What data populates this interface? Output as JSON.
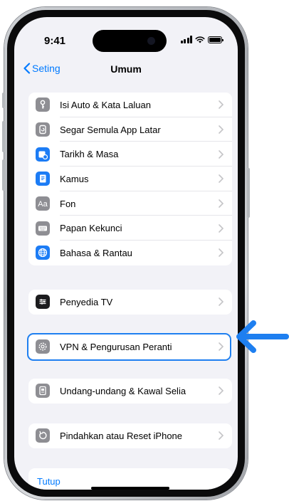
{
  "status_bar": {
    "time": "9:41"
  },
  "nav": {
    "back_label": "Seting",
    "title": "Umum"
  },
  "groups": [
    {
      "items": [
        {
          "label": "Isi Auto & Kata Laluan",
          "icon": "key-icon"
        },
        {
          "label": "Segar Semula App Latar",
          "icon": "refresh-icon"
        },
        {
          "label": "Tarikh & Masa",
          "icon": "calendar-clock-icon"
        },
        {
          "label": "Kamus",
          "icon": "book-icon"
        },
        {
          "label": "Fon",
          "icon": "font-icon"
        },
        {
          "label": "Papan Kekunci",
          "icon": "keyboard-icon"
        },
        {
          "label": "Bahasa & Rantau",
          "icon": "globe-icon"
        }
      ]
    },
    {
      "items": [
        {
          "label": "Penyedia TV",
          "icon": "tv-provider-icon"
        }
      ]
    },
    {
      "items": [
        {
          "label": "VPN & Pengurusan Peranti",
          "icon": "gear-icon"
        }
      ]
    },
    {
      "items": [
        {
          "label": "Undang-undang & Kawal Selia",
          "icon": "document-icon"
        }
      ]
    },
    {
      "items": [
        {
          "label": "Pindahkan atau Reset iPhone",
          "icon": "reset-icon"
        }
      ]
    }
  ],
  "footer": {
    "shutdown_label": "Tutup"
  },
  "colors": {
    "accent": "#007aff",
    "highlight": "#1e7ff0",
    "background": "#f2f2f7"
  },
  "annotation": {
    "highlighted_item": "VPN & Pengurusan Peranti",
    "arrow_icon": "arrow-left-icon"
  }
}
